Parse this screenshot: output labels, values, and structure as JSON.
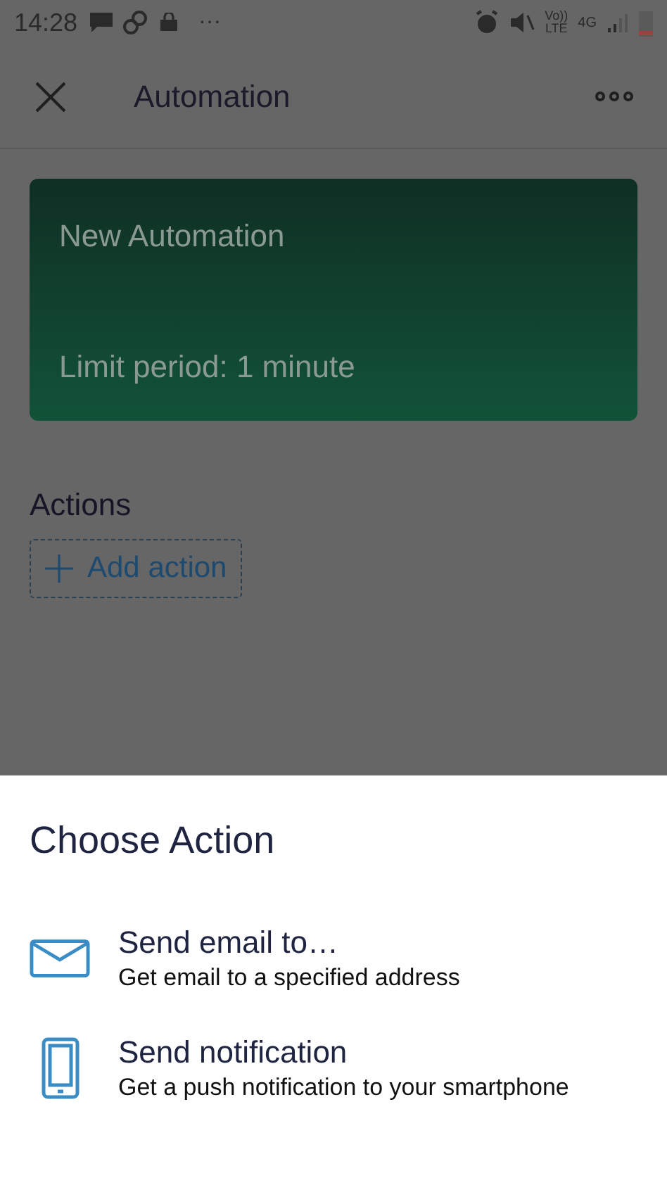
{
  "status_bar": {
    "time": "14:28",
    "more": "···",
    "volte": [
      "Vo))",
      "LTE"
    ],
    "network": "4G"
  },
  "app_bar": {
    "title": "Automation"
  },
  "card": {
    "title": "New Automation",
    "limit": "Limit period: 1 minute"
  },
  "actions_section": {
    "heading": "Actions",
    "add_button": "Add action"
  },
  "sheet": {
    "title": "Choose Action",
    "items": [
      {
        "kind": "email",
        "title": "Send email to…",
        "description": "Get email to a specified address"
      },
      {
        "kind": "phone",
        "title": "Send notification",
        "description": "Get a push notification to your smartphone"
      }
    ]
  }
}
